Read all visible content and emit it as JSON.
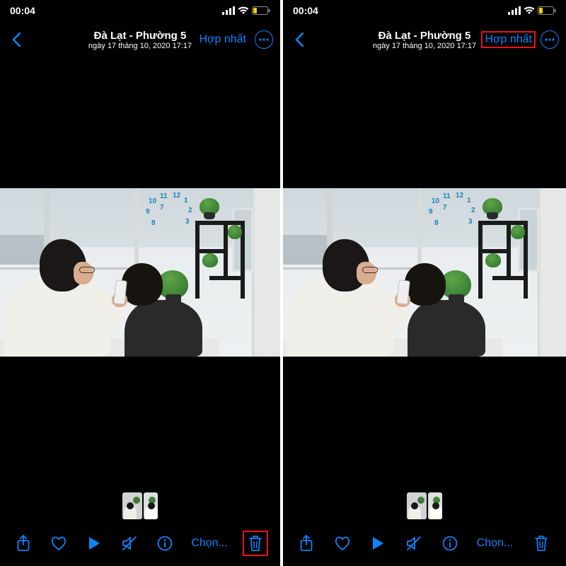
{
  "status": {
    "time": "00:04"
  },
  "nav": {
    "title": "Đà Lạt - Phường 5",
    "subtitle": "ngày 17 tháng 10, 2020  17:17",
    "merge_label": "Hợp nhất"
  },
  "toolbar": {
    "select_label": "Chọn..."
  },
  "icons": {
    "back": "chevron-left",
    "more": "ellipsis-circle",
    "share": "square-arrow-up",
    "heart": "heart",
    "play": "play-fill",
    "mute": "speaker-slash",
    "info": "info-circle",
    "trash": "trash"
  },
  "highlights": {
    "left_screen": "trash-button",
    "right_screen": "merge-button"
  }
}
